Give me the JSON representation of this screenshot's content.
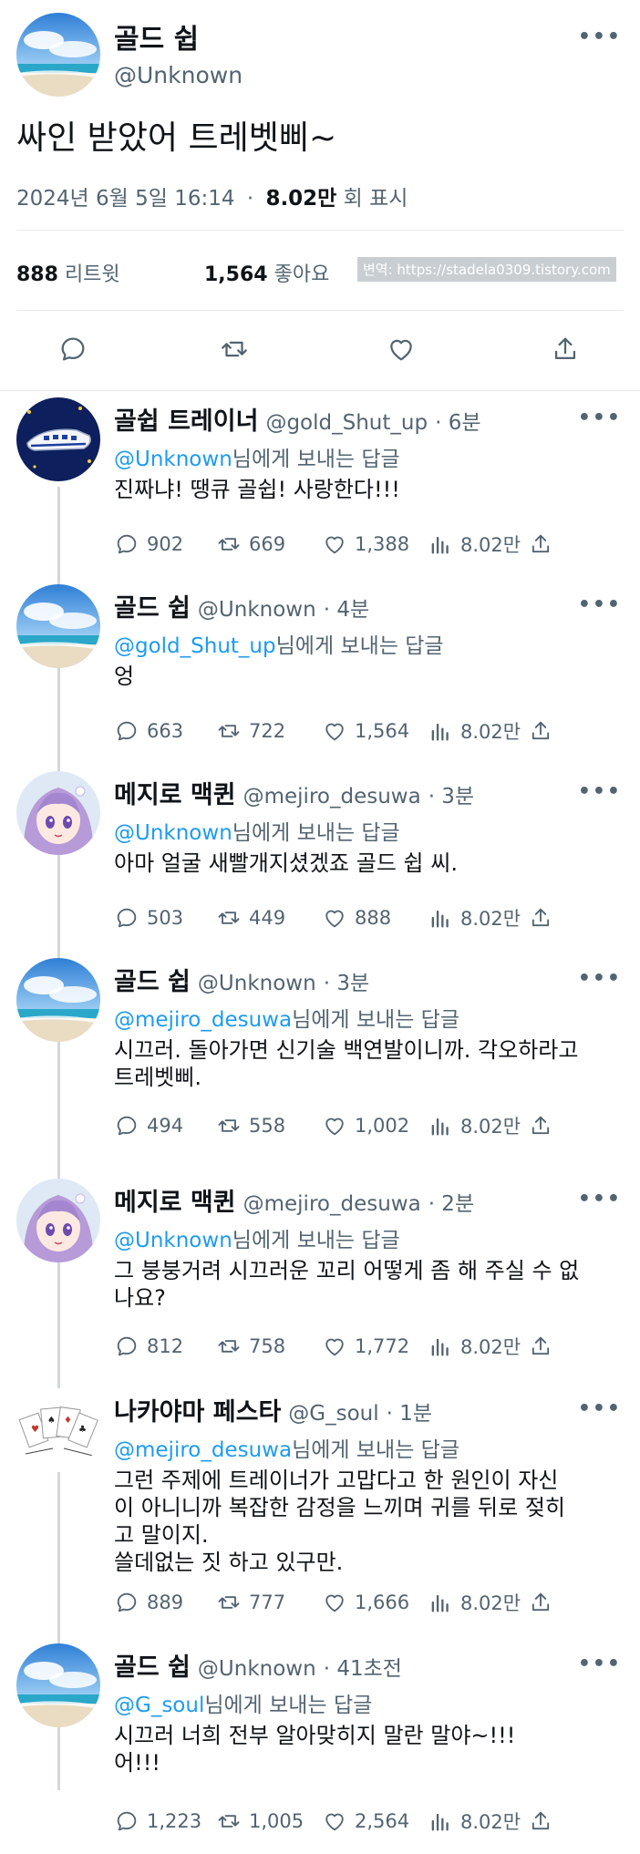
{
  "main_tweet": {
    "author_name": "골드 쉽",
    "author_handle": "@Unknown",
    "text": "싸인 받았어 트레벳삐~",
    "date": "2024년 6월 5일  16:14",
    "separator": "·",
    "views_count": "8.02만",
    "views_label": "회 표시",
    "retweets_count": "888",
    "retweets_label": "리트윗",
    "likes_count": "1,564",
    "likes_label": "좋아요",
    "watermark": "변역: https://stadela0309.tistory.com",
    "more": "•••"
  },
  "reply_to_suffix": "님에게 보내는 답글",
  "colors": {
    "link": "#1d9bf0",
    "muted": "#536471",
    "text": "#0f1419",
    "line": "#cfd9de"
  },
  "replies": [
    {
      "name": "골쉽 트레이너",
      "handle": "@gold_Shut_up",
      "time": "· 6분",
      "reply_to": "@Unknown",
      "text": "진짜냐! 땡큐 골쉽! 사랑한다!!!",
      "reply_count": "902",
      "retweet_count": "669",
      "like_count": "1,388",
      "view_count": "8.02만",
      "avatar": "train-avatar"
    },
    {
      "name": "골드 쉽",
      "handle": "@Unknown",
      "time": "· 4분",
      "reply_to": "@gold_Shut_up",
      "text": "엉",
      "reply_count": "663",
      "retweet_count": "722",
      "like_count": "1,564",
      "view_count": "8.02만",
      "avatar": "beach-avatar"
    },
    {
      "name": "메지로 맥퀸",
      "handle": "@mejiro_desuwa",
      "time": "· 3분",
      "reply_to": "@Unknown",
      "text": "아마 얼굴 새빨개지셨겠죠 골드 쉽 씨.",
      "reply_count": "503",
      "retweet_count": "449",
      "like_count": "888",
      "view_count": "8.02만",
      "avatar": "anime-avatar"
    },
    {
      "name": "골드 쉽",
      "handle": "@Unknown",
      "time": "· 3분",
      "reply_to": "@mejiro_desuwa",
      "text": "시끄러. 돌아가면 신기술 백연발이니까. 각오하라고\n트레벳삐.",
      "reply_count": "494",
      "retweet_count": "558",
      "like_count": "1,002",
      "view_count": "8.02만",
      "avatar": "beach-avatar"
    },
    {
      "name": "메지로 맥퀸",
      "handle": "@mejiro_desuwa",
      "time": "· 2분",
      "reply_to": "@Unknown",
      "text": "그 붕붕거려 시끄러운 꼬리 어떻게 좀 해 주실 수 없\n나요?",
      "reply_count": "812",
      "retweet_count": "758",
      "like_count": "1,772",
      "view_count": "8.02만",
      "avatar": "anime-avatar"
    },
    {
      "name": "나카야마 페스타",
      "handle": "@G_soul",
      "time": "· 1분",
      "reply_to": "@mejiro_desuwa",
      "text": "그런 주제에 트레이너가 고맙다고 한 원인이 자신\n이 아니니까 복잡한 감정을 느끼며 귀를 뒤로 젖히\n고 말이지.\n쓸데없는 짓 하고 있구만.",
      "reply_count": "889",
      "retweet_count": "777",
      "like_count": "1,666",
      "view_count": "8.02만",
      "avatar": "cards-avatar"
    },
    {
      "name": "골드 쉽",
      "handle": "@Unknown",
      "time": "· 41초전",
      "reply_to": "@G_soul",
      "text": "시끄러 너희 전부 알아맞히지 말란 말야~!!!\n어!!!",
      "reply_count": "1,223",
      "retweet_count": "1,005",
      "like_count": "2,564",
      "view_count": "8.02만",
      "avatar": "beach-avatar"
    }
  ]
}
